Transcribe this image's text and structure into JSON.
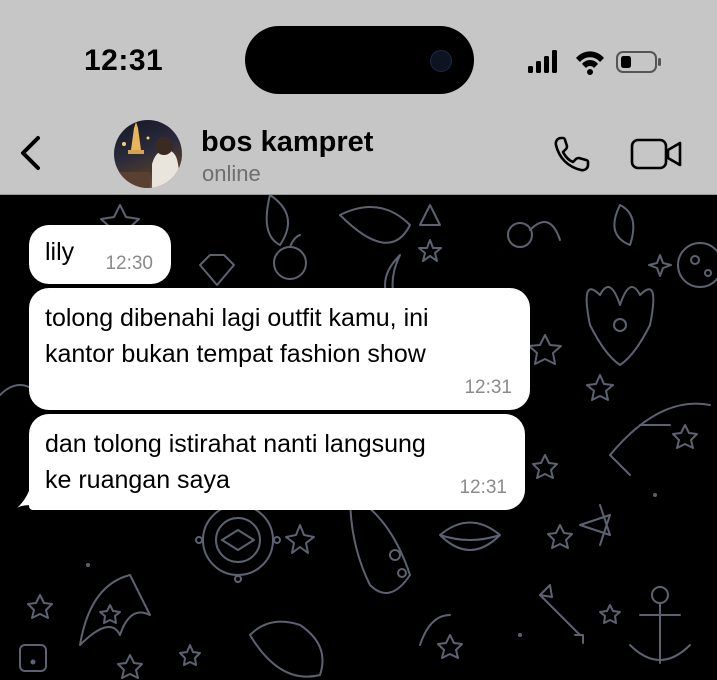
{
  "status_bar": {
    "time": "12:31",
    "signal_icon": "signal-bars-icon",
    "wifi_icon": "wifi-icon",
    "battery_icon": "battery-low-icon"
  },
  "header": {
    "back_icon": "chevron-left-icon",
    "contact_name": "bos kampret",
    "presence": "online",
    "call_icon": "phone-icon",
    "video_icon": "video-camera-icon"
  },
  "messages": [
    {
      "text": "lily",
      "time": "12:30"
    },
    {
      "text": "tolong dibenahi lagi outfit kamu, ini\nkantor bukan tempat fashion show",
      "time": "12:31"
    },
    {
      "text": "dan tolong istirahat nanti langsung\nke ruangan saya",
      "time": "12:31"
    }
  ],
  "colors": {
    "header_bg": "#c6c6c6",
    "chat_bg": "#000000",
    "bubble_bg": "#ffffff",
    "doodle": "#5d6270"
  }
}
